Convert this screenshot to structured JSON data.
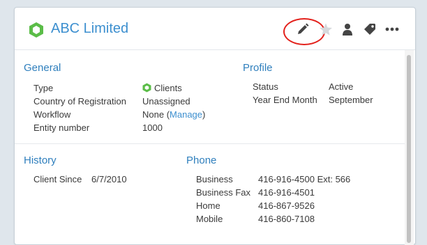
{
  "header": {
    "title": "ABC Limited",
    "icons": [
      "hexagon-icon",
      "pencil-icon",
      "star-icon",
      "person-icon",
      "tag-icon",
      "more-dots-icon"
    ]
  },
  "general": {
    "title": "General",
    "type_label": "Type",
    "type_value": "Clients",
    "country_label": "Country of Registration",
    "country_value": "Unassigned",
    "workflow_label": "Workflow",
    "workflow_value": "None (",
    "workflow_link": "Manage",
    "workflow_suffix": ")",
    "entity_label": "Entity number",
    "entity_value": "1000"
  },
  "profile": {
    "title": "Profile",
    "status_label": "Status",
    "status_value": "Active",
    "yearend_label": "Year End Month",
    "yearend_value": "September"
  },
  "history": {
    "title": "History",
    "client_since_label": "Client Since",
    "client_since_value": "6/7/2010"
  },
  "phone": {
    "title": "Phone",
    "rows": [
      {
        "label": "Business",
        "value": "416-916-4500 Ext: 566"
      },
      {
        "label": "Business Fax",
        "value": "416-916-4501"
      },
      {
        "label": "Home",
        "value": "416-867-9526"
      },
      {
        "label": "Mobile",
        "value": "416-860-7108"
      }
    ]
  },
  "colors": {
    "accent": "#3c8fcf",
    "hex_green": "#5bbd48",
    "highlight_ring": "#e3211c"
  }
}
